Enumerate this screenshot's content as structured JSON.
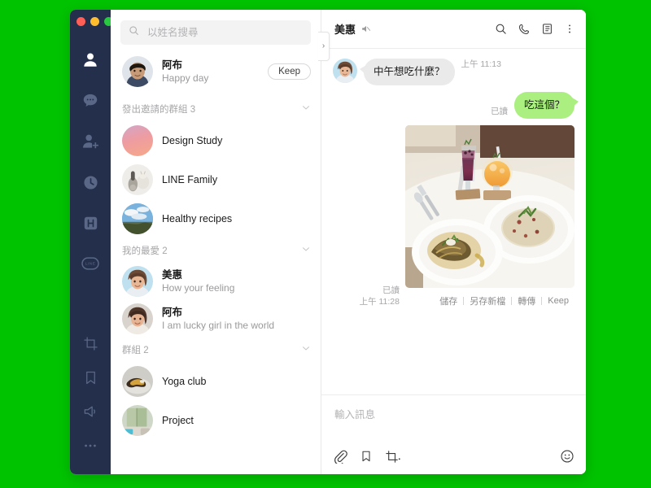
{
  "theme": {
    "desktop_bg": "#00c300",
    "rail_bg": "#232f4b",
    "accent_green": "#aaef80",
    "incoming_bubble": "#eaeaea"
  },
  "window_controls": {
    "close": "close-red",
    "minimize": "minimize-yellow",
    "maximize": "maximize-green"
  },
  "nav_rail": {
    "top_items": [
      {
        "name": "friends",
        "icon": "person-icon",
        "active": true
      },
      {
        "name": "chats",
        "icon": "chat-bubble-icon",
        "active": false
      },
      {
        "name": "add-friend",
        "icon": "add-friend-icon",
        "active": false
      },
      {
        "name": "timeline",
        "icon": "clock-icon",
        "active": false
      },
      {
        "name": "line-today",
        "icon": "h-square-icon",
        "active": false
      },
      {
        "name": "line-service",
        "icon": "line-logo-icon",
        "active": false
      }
    ],
    "bottom_items": [
      {
        "name": "screenshot",
        "icon": "crop-icon"
      },
      {
        "name": "keep",
        "icon": "bookmark-icon"
      },
      {
        "name": "announcements",
        "icon": "megaphone-icon"
      },
      {
        "name": "more",
        "icon": "ellipsis-icon"
      }
    ]
  },
  "search": {
    "placeholder": "以姓名搜尋",
    "value": "",
    "icon": "search-icon"
  },
  "collapse_handle": {
    "label": "›"
  },
  "profile": {
    "name": "阿布",
    "status": "Happy day",
    "keep_label": "Keep"
  },
  "sections": [
    {
      "title": "發出邀請的群組",
      "count": "3",
      "items": [
        {
          "name": "Design Study",
          "avatar": "gradient-pink"
        },
        {
          "name": "LINE Family",
          "avatar": "photo-dolls"
        },
        {
          "name": "Healthy recipes",
          "avatar": "photo-sky"
        }
      ]
    },
    {
      "title": "我的最愛",
      "count": "2",
      "items": [
        {
          "name": "美惠",
          "sub": "How your feeling",
          "avatar": "photo-woman-blue"
        },
        {
          "name": "阿布",
          "sub": "I am lucky girl in the world",
          "avatar": "photo-woman-beige"
        }
      ]
    },
    {
      "title": "群組",
      "count": "2",
      "items": [
        {
          "name": "Yoga club",
          "avatar": "photo-yoga"
        },
        {
          "name": "Project",
          "avatar": "photo-room"
        }
      ]
    }
  ],
  "chat": {
    "title": "美惠",
    "muted_icon": "mute-speaker-icon",
    "header_actions": [
      {
        "name": "search",
        "icon": "search-icon"
      },
      {
        "name": "call",
        "icon": "phone-icon"
      },
      {
        "name": "notes",
        "icon": "note-icon"
      },
      {
        "name": "more",
        "icon": "vertical-dots-icon"
      }
    ],
    "messages": [
      {
        "direction": "in",
        "sender": "美惠",
        "text": "中午想吃什麼？",
        "time": "上午 11:13"
      },
      {
        "direction": "out",
        "text": "吃這個？",
        "read_label": "已讀"
      },
      {
        "direction": "out",
        "type": "image",
        "read_label": "已讀",
        "time": "上午 11:28",
        "alt": "兩盤義大利麵與兩杯飲料的餐桌照片",
        "actions": [
          "儲存",
          "另存新檔",
          "轉傳",
          "Keep"
        ]
      }
    ]
  },
  "composer": {
    "placeholder": "輸入訊息",
    "value": "",
    "tools": [
      {
        "name": "attach-file",
        "icon": "paperclip-icon"
      },
      {
        "name": "keep-save",
        "icon": "bookmark-icon"
      },
      {
        "name": "screenshot",
        "icon": "crop-icon"
      },
      {
        "name": "emoji",
        "icon": "smiley-icon"
      }
    ]
  }
}
